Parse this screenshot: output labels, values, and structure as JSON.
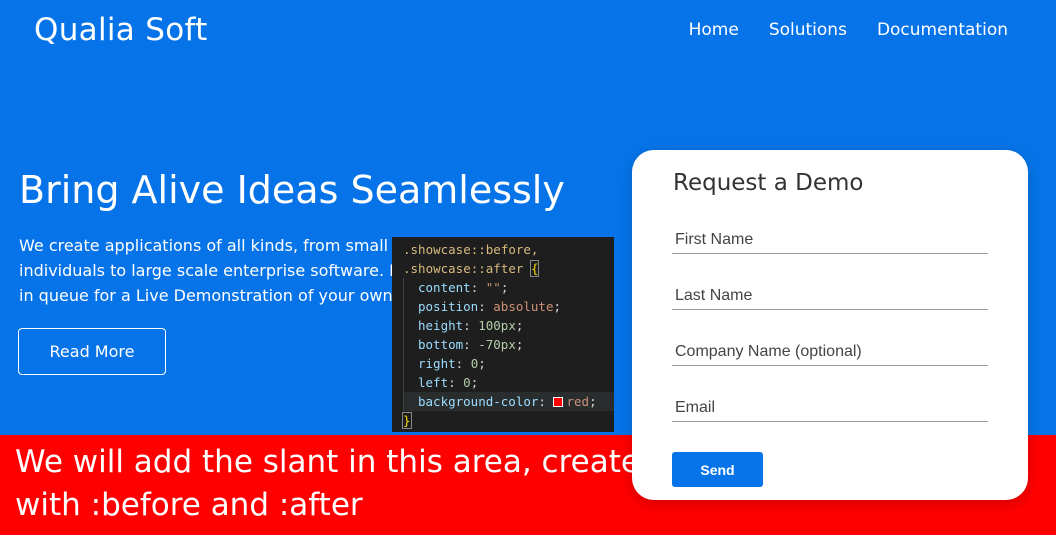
{
  "brand": {
    "name": "Qualia Soft"
  },
  "nav": {
    "items": [
      "Home",
      "Solutions",
      "Documentation"
    ]
  },
  "hero": {
    "headline": "Bring Alive Ideas Seamlessly",
    "lead_lines": [
      "We create applications of all kinds, from small s",
      "individuals to large scale enterprise software. Fil",
      "in queue for a Live Demonstration of your own i"
    ],
    "read_more": "Read More"
  },
  "code": {
    "lines": [
      ".showcase::before,",
      ".showcase::after",
      "content: \"\";",
      "position: absolute;",
      "height: 100px;",
      "bottom: -70px;",
      "right: 0;",
      "left: 0;",
      "background-color: red;",
      "}"
    ],
    "open_brace": "{",
    "props": [
      {
        "name": "content",
        "value": "\"\""
      },
      {
        "name": "position",
        "value": "absolute"
      },
      {
        "name": "height",
        "value": "100px"
      },
      {
        "name": "bottom",
        "value": "-70px"
      },
      {
        "name": "right",
        "value": "0"
      },
      {
        "name": "left",
        "value": "0"
      },
      {
        "name": "background-color",
        "value": "red"
      }
    ]
  },
  "band": {
    "lines": [
      "We will add the slant in this area, created",
      "with :before and :after"
    ]
  },
  "form": {
    "title": "Request a Demo",
    "fields": [
      {
        "placeholder": "First Name"
      },
      {
        "placeholder": "Last Name"
      },
      {
        "placeholder": "Company Name (optional)"
      },
      {
        "placeholder": "Email"
      }
    ],
    "submit": "Send"
  },
  "colors": {
    "primary": "#0674e8",
    "band": "#ff0000",
    "white": "#ffffff"
  }
}
